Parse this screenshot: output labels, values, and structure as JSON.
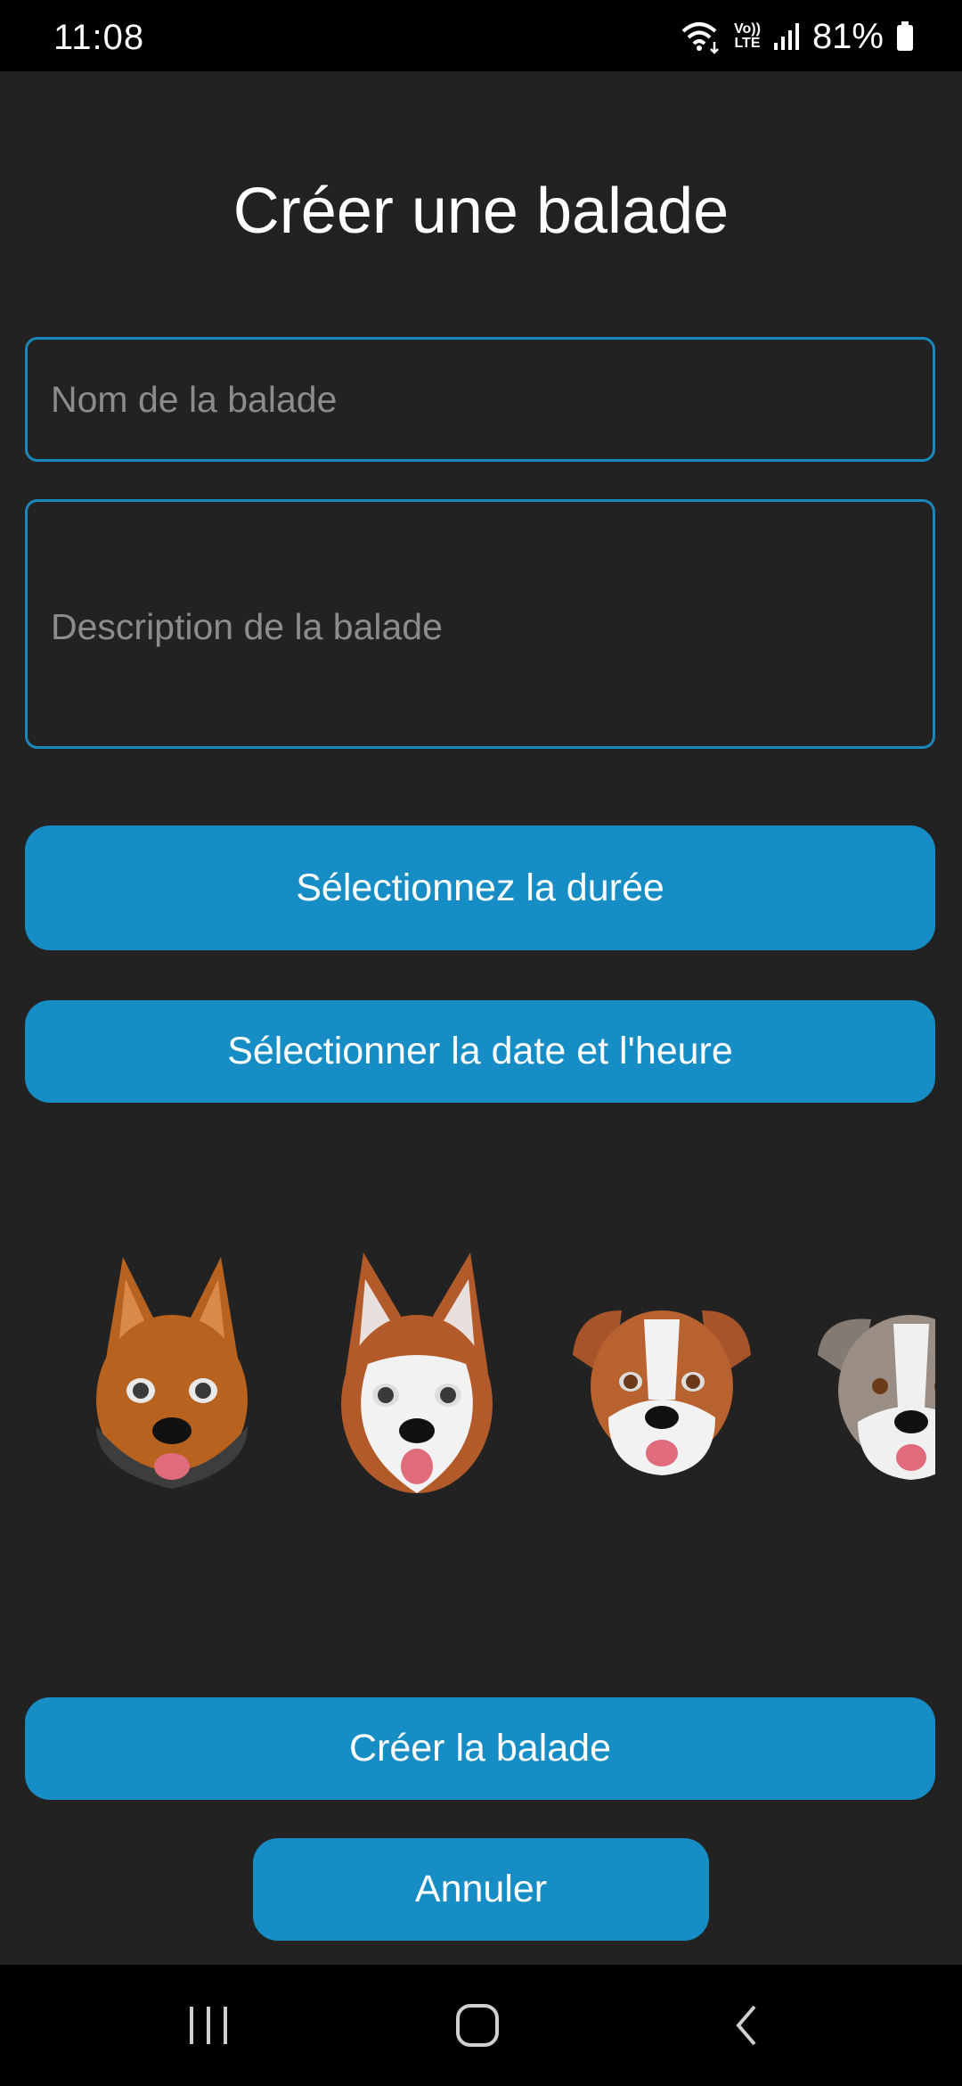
{
  "status_bar": {
    "time": "11:08",
    "volte_top": "Vo))",
    "volte_bottom": "LTE",
    "battery": "81%",
    "icons": [
      "wifi-icon",
      "volte-icon",
      "signal-icon",
      "battery-icon"
    ]
  },
  "page": {
    "title": "Créer une balade"
  },
  "form": {
    "name_placeholder": "Nom de la balade",
    "name_value": "",
    "description_placeholder": "Description de la balade",
    "description_value": ""
  },
  "buttons": {
    "duration": "Sélectionnez la durée",
    "datetime": "Sélectionner la date et l'heure",
    "create": "Créer la balade",
    "cancel": "Annuler"
  },
  "avatars": [
    "german-shepherd-avatar",
    "husky-avatar",
    "boxer-avatar",
    "pitbull-avatar"
  ],
  "colors": {
    "background": "#222222",
    "accent": "#168dc5",
    "field_border": "#1a87bd",
    "placeholder": "#8c8c8c"
  },
  "nav_bar": {
    "icons": [
      "recent-apps-icon",
      "home-icon",
      "back-icon"
    ]
  }
}
